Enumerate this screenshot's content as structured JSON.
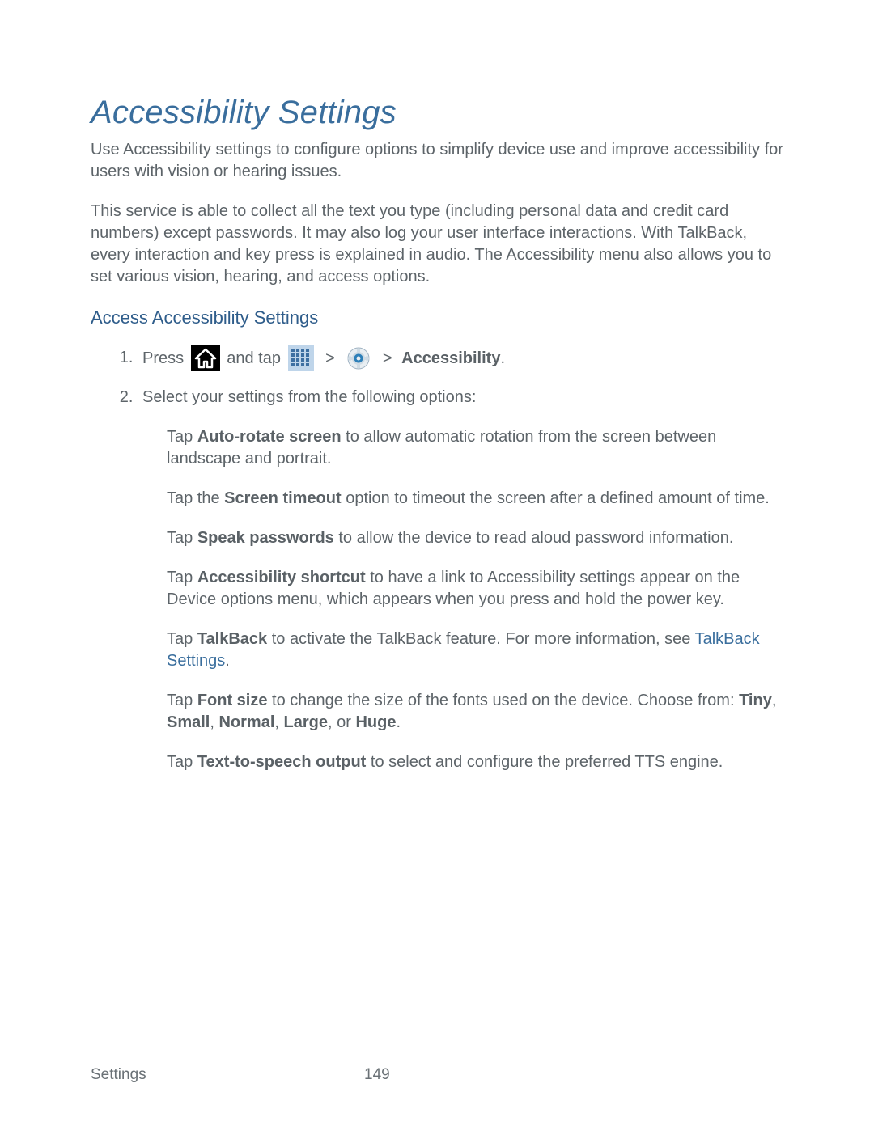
{
  "title": "Accessibility Settings",
  "intro1": "Use Accessibility settings to configure options to simplify device use and improve accessibility for users with vision or hearing issues.",
  "intro2": "This service is able to collect all the text you type (including personal data and credit card numbers) except passwords. It may also log your user interface interactions. With TalkBack, every interaction and key press is explained in audio. The Accessibility menu also allows you to set various vision, hearing, and access options.",
  "subhead": "Access Accessibility Settings",
  "steps": {
    "s1": {
      "press": "Press ",
      "and_tap": " and tap ",
      "gt1": ">",
      "gt2": ">",
      "accessibility_label": "Accessibility",
      "period": "."
    },
    "s2": "Select your settings from the following options:"
  },
  "options": {
    "o1_pre": "Tap ",
    "o1_b": "Auto-rotate screen",
    "o1_post": " to allow automatic rotation from the screen between landscape and portrait.",
    "o2_pre": "Tap the ",
    "o2_b": "Screen timeout",
    "o2_post": " option to timeout the screen after a defined amount of time.",
    "o3_pre": "Tap ",
    "o3_b": "Speak passwords",
    "o3_post": " to allow the device to read aloud password information.",
    "o4_pre": "Tap ",
    "o4_b": "Accessibility shortcut",
    "o4_post": " to have a link to Accessibility settings appear on the Device options menu, which appears when you press and hold the power key.",
    "o5_pre": "Tap ",
    "o5_b": "TalkBack",
    "o5_mid": " to activate the TalkBack feature. For more information, see ",
    "o5_link": "TalkBack Settings",
    "o5_post": ".",
    "o6_pre": "Tap ",
    "o6_b": "Font size",
    "o6_mid": " to change the size of the fonts used on the device. Choose from: ",
    "o6_b1": "Tiny",
    "o6_c1": ", ",
    "o6_b2": "Small",
    "o6_c2": ", ",
    "o6_b3": "Normal",
    "o6_c3": ", ",
    "o6_b4": "Large",
    "o6_c4": ", or ",
    "o6_b5": "Huge",
    "o6_post": ".",
    "o7_pre": "Tap ",
    "o7_b": "Text-to-speech output",
    "o7_post": " to select and configure the preferred TTS engine."
  },
  "footer": {
    "section": "Settings",
    "page": "149"
  }
}
